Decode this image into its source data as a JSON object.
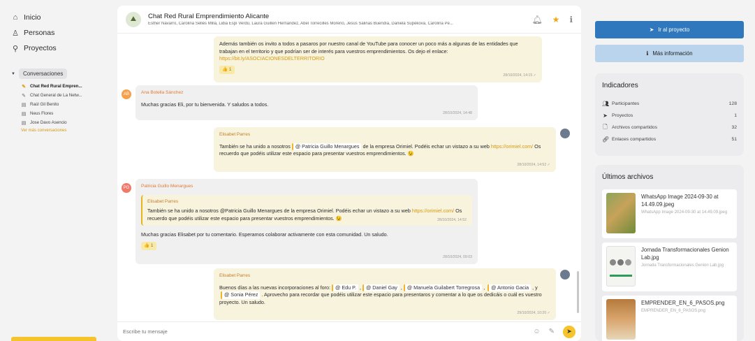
{
  "sidebar": {
    "nav": [
      {
        "label": "Inicio",
        "icon": "home-icon"
      },
      {
        "label": "Personas",
        "icon": "user-icon"
      },
      {
        "label": "Proyectos",
        "icon": "sitemap-icon"
      }
    ],
    "conversations_label": "Conversaciones",
    "conversations": [
      {
        "label": "Chat Red Rural Empren...",
        "icon": "group-chat-icon",
        "active": true
      },
      {
        "label": "Chat General de La Netw...",
        "icon": "group-chat-icon",
        "active": false
      },
      {
        "label": "Raúl Gil Benito",
        "icon": "message-icon",
        "active": false
      },
      {
        "label": "Neus Flores",
        "icon": "message-icon",
        "active": false
      },
      {
        "label": "Jose Davo Asencio",
        "icon": "message-icon",
        "active": false
      }
    ],
    "see_more": "Ver más conversaciones"
  },
  "chat": {
    "title": "Chat Red Rural Emprendimiento Alicante",
    "members": "Esther Navarro, Carolina Sellés Millá, Lidia Espí Verdú, Laura Guillen Hernandez, Abel Torrecilles Moreno, Jesús Salinas Buendía, Daniela Supekova, Carolina Pe...",
    "messages": {
      "m1": {
        "text": "Además también os invito a todos a pasaros por nuestro canal de YouTube para conocer un poco más a algunas de las entidades que trabajan en el territorio y que podrían ser de interés para vuestros emprendimientos. Os dejo el enlace:",
        "link": "https://bit.ly/ASOCIACIONESDELTERRITORIO",
        "reaction": "👍 1",
        "time": "28/10/2024, 14:15 ✓"
      },
      "m2": {
        "avatar": "AB",
        "sender": "Ana Botella Sánchez",
        "text": "Muchas gracias Eli, por tu bienvenida. Y saludos a todos.",
        "time": "28/10/2024, 14:48"
      },
      "m3": {
        "sender": "Elisabet Parres",
        "text_a": "También se ha unido a nosotros",
        "mention": "@ Patricia Guillo Menargues",
        "text_b": "de la empresa Orimiel. Podéis echar un vistazo a su web",
        "link": "https://orimiel.com/",
        "text_c": "Os recuerdo que podéis utilizar este espacio para presentar vuestros emprendimientos. 😉",
        "time": "28/10/2024, 14:52 ✓"
      },
      "m4": {
        "avatar": "PG",
        "sender": "Patricia Guillo Menargues",
        "quote_sender": "Elisabet Parres",
        "quote_text": "También se ha unido a nosotros @Patricia Guillo Menargues de la empresa Orimiel. Podéis echar un vistazo a su web",
        "quote_link": "https://orimiel.com/",
        "quote_text_b": "Os recuerdo que podéis utilizar este espacio para presentar vuestros emprendimientos. 😉",
        "quote_time": "28/10/2024, 14:52",
        "text": "Muchas gracias Elisabet por tu comentario. Esperamos colaborar activamente con esta comunidad. Un saludo.",
        "reaction": "👍 1",
        "time": "28/10/2024, 09:03"
      },
      "m5": {
        "sender": "Elisabet Parres",
        "text_a": "Buenos días a las nuevas incorporaciones al foro:",
        "mention_1": "@ Edu P.",
        "mention_2": "@ Daniel Gay",
        "mention_3": "@ Manuela Guilabert Torregrosa",
        "mention_4": "@ Antonio Gacia",
        "text_y": ", y",
        "mention_5": "@ Sonia Pérez",
        "text_b": ". Aprovecho para recordar que podéis utilizar este espacio para presentaros y comentar a lo que os dedicáis o cuál es vuestro proyecto. Un saludo.",
        "time": "29/10/2024, 10:20 ✓"
      }
    },
    "composer_placeholder": "Escribe tu mensaje"
  },
  "right": {
    "primary_button": "Ir al proyecto",
    "secondary_button": "Más información",
    "indicators": {
      "title": "Indicadores",
      "rows": [
        {
          "label": "Participantes",
          "value": "128",
          "icon": "users-icon"
        },
        {
          "label": "Proyectos",
          "value": "1",
          "icon": "send-icon"
        },
        {
          "label": "Archivos compartidos",
          "value": "32",
          "icon": "file-icon"
        },
        {
          "label": "Enlaces compartidos",
          "value": "51",
          "icon": "link-icon"
        }
      ]
    },
    "files": {
      "title": "Últimos archivos",
      "items": [
        {
          "name": "WhatsApp Image 2024-09-30 at 14.49.09.jpeg",
          "sub": "WhatsApp Image 2024-09-30 at 14.49.09.jpeg"
        },
        {
          "name": "Jornada Transformacionales Genion Lab.jpg",
          "sub": "Jornada Transformacionales Genion Lab.jpg"
        },
        {
          "name": "EMPRENDER_EN_6_PASOS.png",
          "sub": "EMPRENDER_EN_6_PASOS.png"
        }
      ]
    }
  },
  "colors": {
    "accent_yellow": "#f5c32b",
    "primary_blue": "#2f78bd",
    "secondary_blue": "#b9d4ec",
    "bubble_yellow": "#f7f3dd",
    "bubble_grey": "#f0f0f1"
  }
}
